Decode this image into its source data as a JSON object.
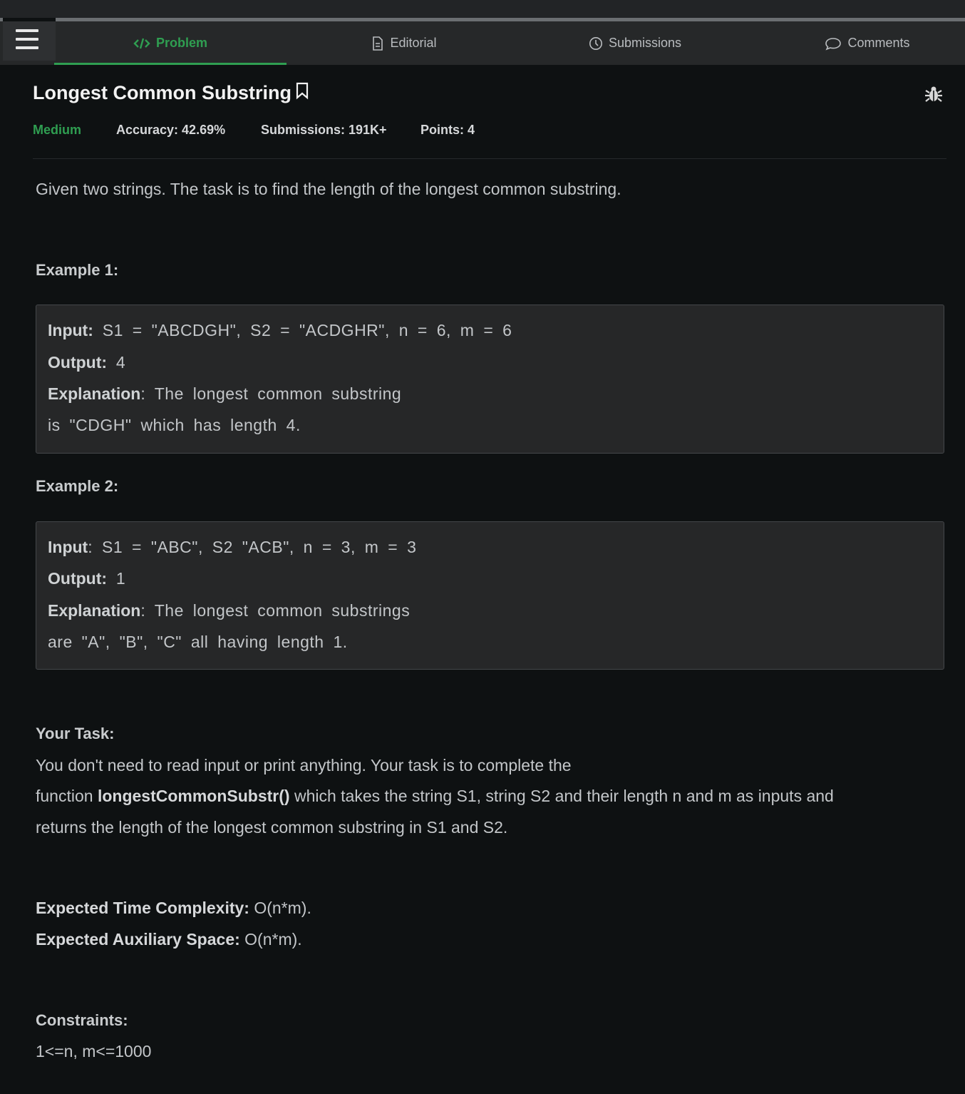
{
  "tabs": [
    {
      "label": "Problem",
      "icon": "code-icon",
      "active": true
    },
    {
      "label": "Editorial",
      "icon": "document-icon",
      "active": false
    },
    {
      "label": "Submissions",
      "icon": "clock-icon",
      "active": false
    },
    {
      "label": "Comments",
      "icon": "comment-icon",
      "active": false
    }
  ],
  "problem": {
    "title": "Longest Common Substring",
    "difficulty": "Medium",
    "accuracy": "Accuracy: 42.69%",
    "submissions": "Submissions: 191K+",
    "points": "Points: 4",
    "statement": "Given two strings. The task is to find the length of the longest common substring."
  },
  "examples": [
    {
      "heading": "Example 1:",
      "input_label": "Input:",
      "input": "S1 = \"ABCDGH\", S2 = \"ACDGHR\", n = 6, m = 6",
      "output_label": "Output:",
      "output": "4",
      "explanation_label": "Explanation",
      "explanation_1": ": The longest common substring",
      "explanation_2": "is \"CDGH\" which has length 4."
    },
    {
      "heading": "Example 2:",
      "input_label": "Input",
      "input": ": S1 = \"ABC\", S2 \"ACB\", n = 3, m = 3",
      "output_label": "Output:",
      "output": "1",
      "explanation_label": "Explanation",
      "explanation_1": ": The longest common substrings",
      "explanation_2": "are \"A\", \"B\", \"C\" all having length 1."
    }
  ],
  "task": {
    "heading": "Your Task:",
    "line1": "You don't need to read input or print anything. Your task is to complete the",
    "line2_prefix": "function ",
    "function_name": "longestCommonSubstr()",
    "line2_suffix": " which takes the string S1, string S2 and their length n and m as inputs and",
    "line3": "returns the length of the longest common substring in S1 and S2."
  },
  "complexity": {
    "time_label": "Expected Time Complexity:",
    "time_value": " O(n*m).",
    "space_label": "Expected Auxiliary Space:",
    "space_value": " O(n*m)."
  },
  "constraints": {
    "heading": "Constraints:",
    "value": "1<=n, m<=1000"
  },
  "colors": {
    "accent": "#2f9e51",
    "background": "#0e1112",
    "navbar": "#262829",
    "example_box": "#262728"
  }
}
